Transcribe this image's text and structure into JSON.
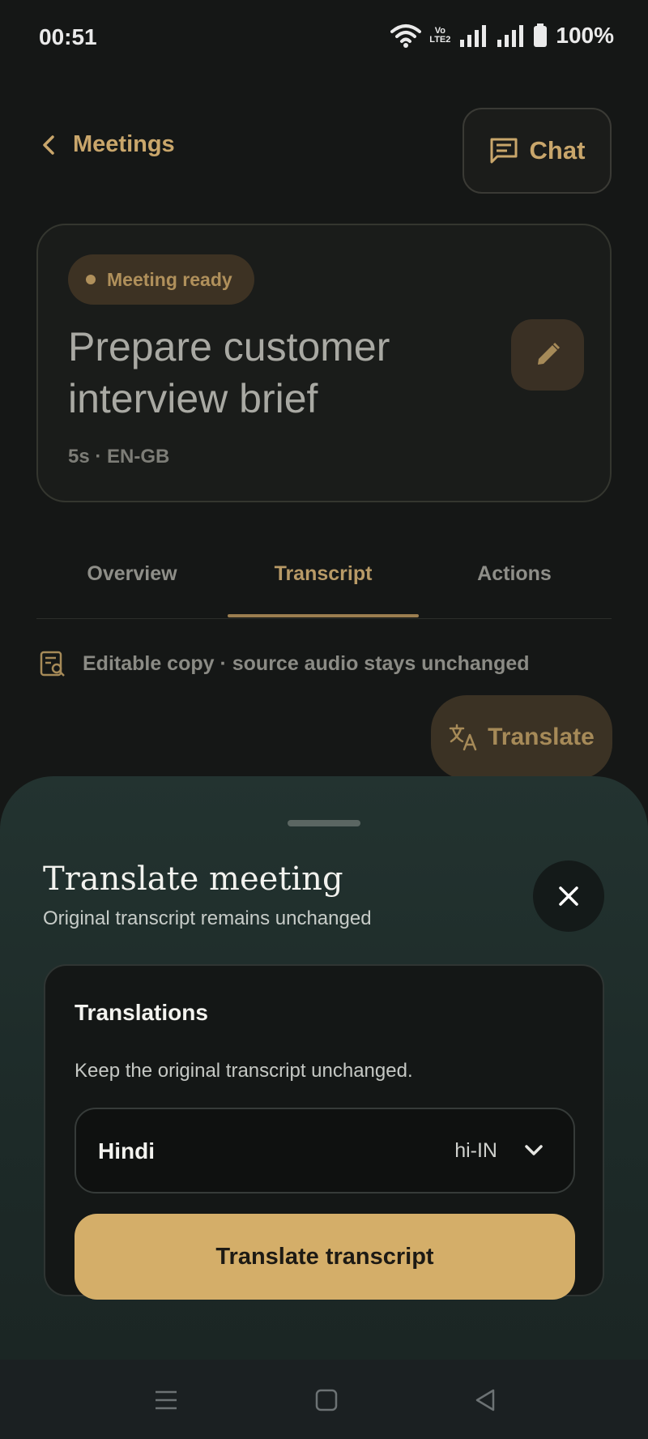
{
  "status_bar": {
    "time": "00:51",
    "volte_top": "Vo",
    "volte_bottom": "LTE2",
    "battery": "100%"
  },
  "header": {
    "back_label": "Meetings",
    "chat_label": "Chat"
  },
  "meeting": {
    "status_chip": "Meeting ready",
    "title": "Prepare customer interview brief",
    "meta": "5s · EN-GB"
  },
  "tabs": [
    {
      "label": "Overview",
      "active": false
    },
    {
      "label": "Transcript",
      "active": true
    },
    {
      "label": "Actions",
      "active": false
    }
  ],
  "note": "Editable copy · source audio stays unchanged",
  "translate_pill": "Translate",
  "sheet": {
    "title": "Translate meeting",
    "subtitle": "Original transcript remains unchanged",
    "panel_heading": "Translations",
    "panel_hint": "Keep the original transcript unchanged.",
    "language_name": "Hindi",
    "language_code": "hi-IN",
    "cta_label": "Translate transcript"
  },
  "colors": {
    "accent": "#c9a66b",
    "cta": "#d4ae69",
    "background": "#151716",
    "sheet": "#233330"
  }
}
